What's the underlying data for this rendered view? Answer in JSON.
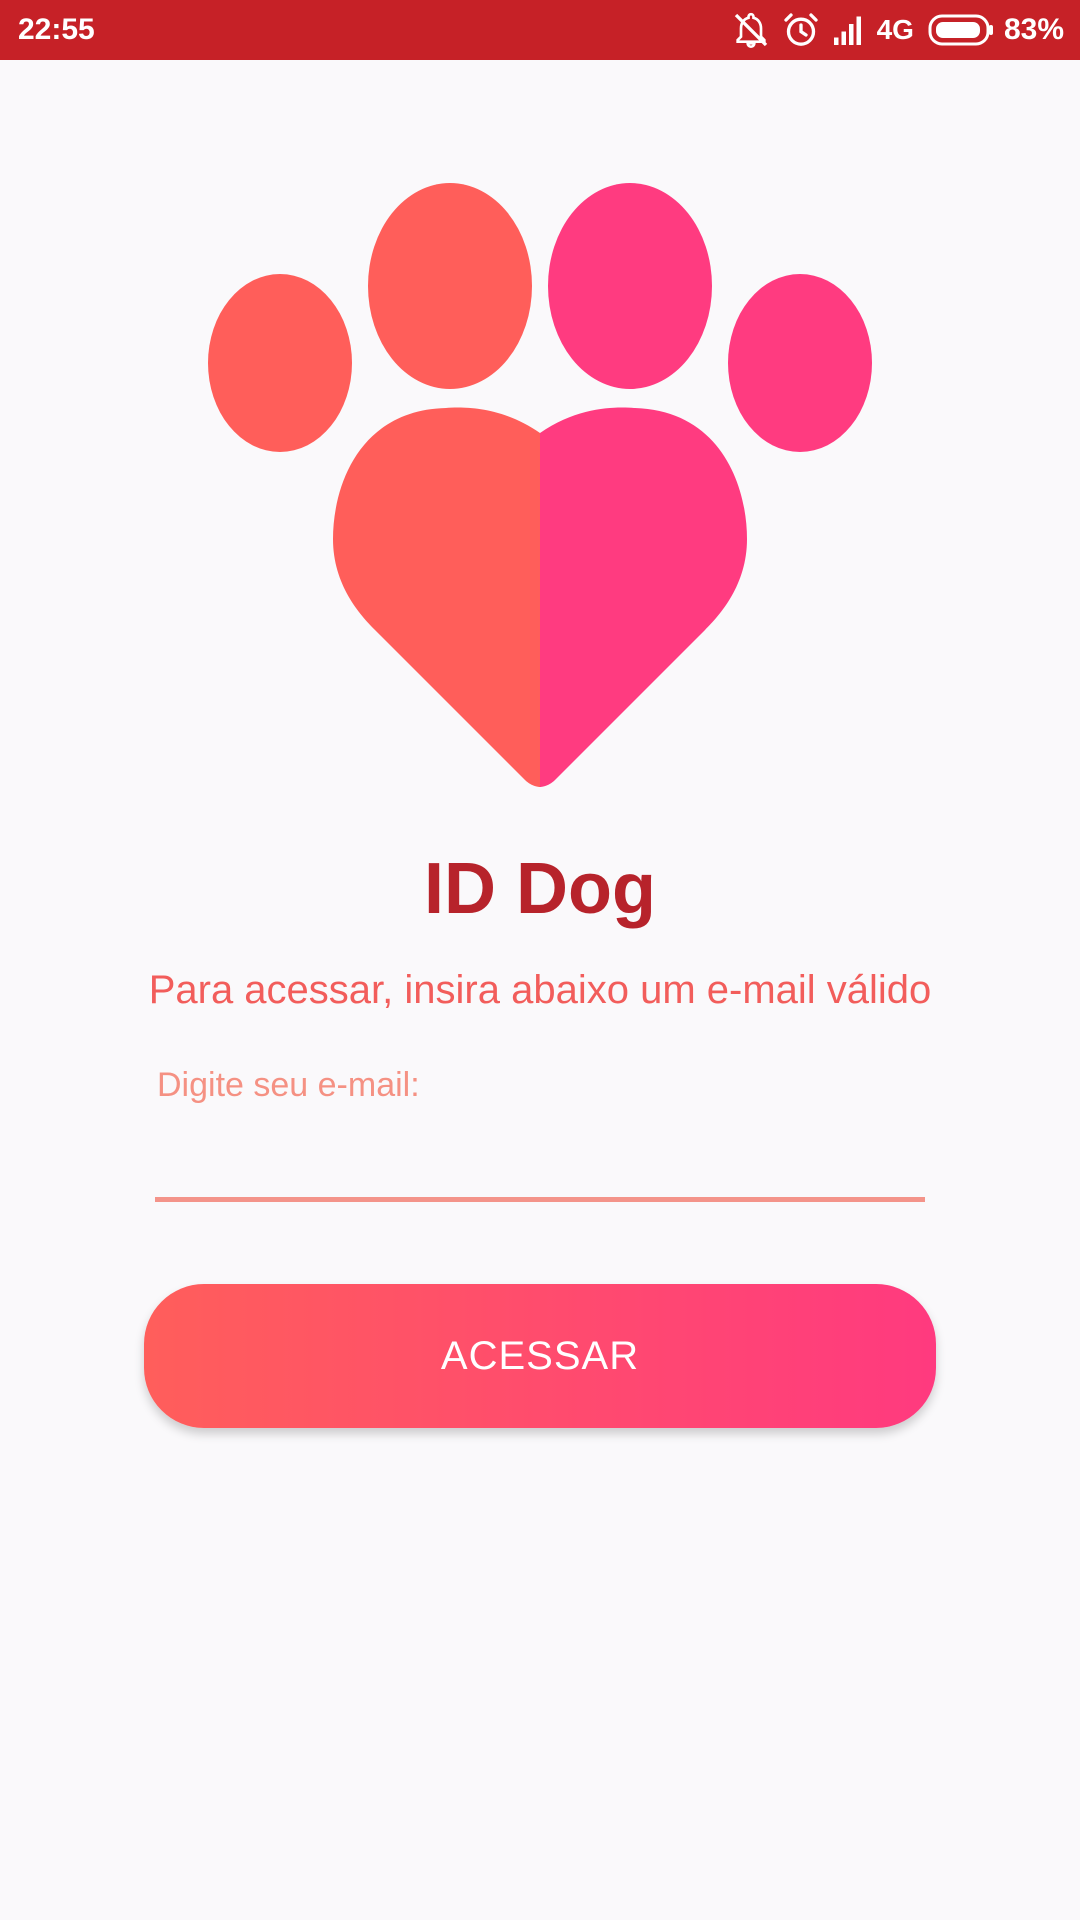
{
  "status_bar": {
    "time": "22:55",
    "network": "4G",
    "battery_percent": "83%",
    "icons": [
      "notifications-off-icon",
      "alarm-icon",
      "signal-icon",
      "battery-icon"
    ],
    "background_color": "#c62127"
  },
  "logo": {
    "icon": "paw-heart-icon",
    "colors": {
      "left": "#ff5e5a",
      "right": "#ff3b80"
    }
  },
  "app": {
    "title": "ID Dog",
    "subtitle": "Para acessar, insira abaixo um e-mail válido"
  },
  "form": {
    "email_label": "Digite seu e-mail:",
    "email_value": "",
    "submit_label": "ACESSAR"
  },
  "colors": {
    "title": "#b7232b",
    "subtitle": "#f25d5b",
    "field_label": "#f59183",
    "underline": "#f4948a",
    "button_gradient_start": "#ff5e5b",
    "button_gradient_end": "#ff3a7f"
  }
}
